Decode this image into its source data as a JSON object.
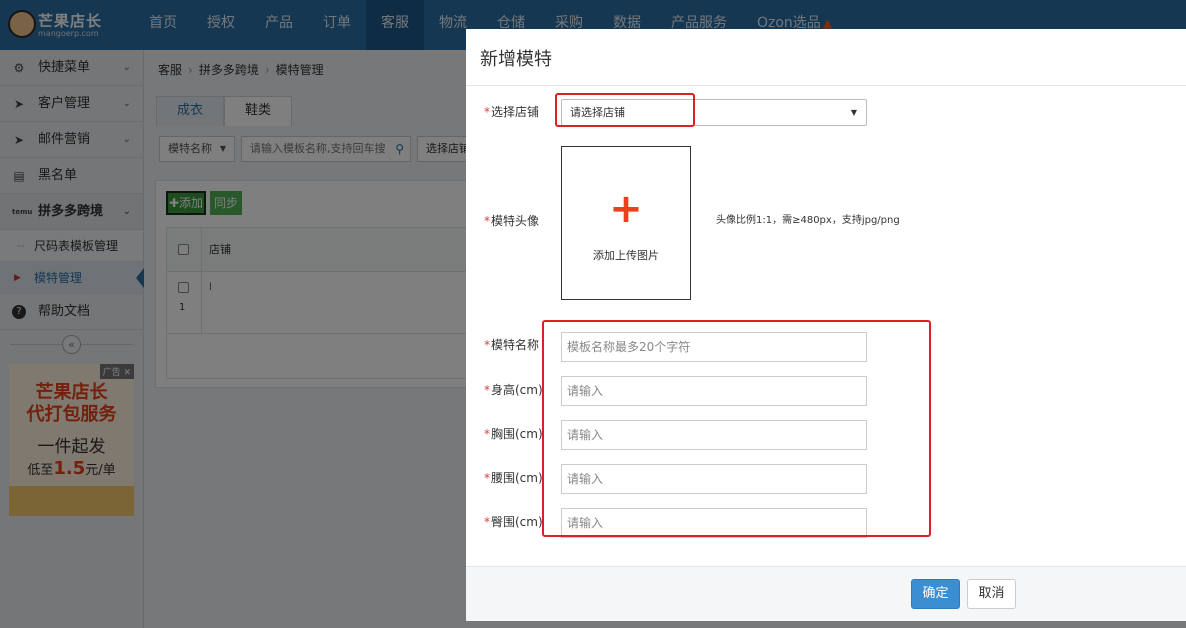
{
  "brand": {
    "name": "芒果店长",
    "domain": "mangoerp.com"
  },
  "nav": [
    {
      "label": "首页"
    },
    {
      "label": "授权"
    },
    {
      "label": "产品"
    },
    {
      "label": "订单"
    },
    {
      "label": "客服",
      "active": true
    },
    {
      "label": "物流"
    },
    {
      "label": "仓储"
    },
    {
      "label": "采购"
    },
    {
      "label": "数据"
    },
    {
      "label": "产品服务"
    },
    {
      "label": "Ozon选品"
    }
  ],
  "sidebar": {
    "items": [
      {
        "label": "快捷菜单",
        "icon": "gear-icon"
      },
      {
        "label": "客户管理",
        "icon": "paper-plane-icon"
      },
      {
        "label": "邮件营销",
        "icon": "paper-plane-icon"
      },
      {
        "label": "黑名单",
        "icon": "blacklist-icon"
      },
      {
        "label": "拼多多跨境",
        "icon": "temu-icon"
      }
    ],
    "subs": [
      {
        "label": "尺码表模板管理"
      },
      {
        "label": "模特管理"
      }
    ],
    "help": "帮助文档"
  },
  "ad": {
    "badge": "广告",
    "line1": "芒果店长",
    "line2": "代打包服务",
    "line3": "一件起发",
    "line4_pre": "低至",
    "line4_num": "1.5",
    "line4_post": "元/单"
  },
  "breadcrumb": [
    "客服",
    "拼多多跨境",
    "模特管理"
  ],
  "tabs": [
    {
      "label": "成衣",
      "active": true
    },
    {
      "label": "鞋类"
    }
  ],
  "filter": {
    "select_label": "模特名称",
    "search_placeholder": "请输入模板名称,支持回车搜",
    "shop_label": "选择店铺"
  },
  "list": {
    "add_label": "添加",
    "sync_label": "同步",
    "header_shop": "店铺",
    "row_index": "1",
    "row_shop": "l"
  },
  "modal": {
    "title": "新增模特",
    "shop_label": "选择店铺",
    "shop_value": "请选择店铺",
    "avatar_label": "模特头像",
    "upload_text": "添加上传图片",
    "avatar_hint": "头像比例1:1，需≥480px，支持jpg/png",
    "name_label": "模特名称",
    "name_placeholder": "模板名称最多20个字符",
    "height_label": "身高(cm)",
    "chest_label": "胸围(cm)",
    "waist_label": "腰围(cm)",
    "hip_label": "臀围(cm)",
    "input_placeholder": "请输入",
    "ok_label": "确定",
    "cancel_label": "取消"
  },
  "colors": {
    "topbar": "#2a6fa3",
    "primary": "#3b8ed2",
    "highlight": "#e02020",
    "success": "#3a9a3f"
  }
}
